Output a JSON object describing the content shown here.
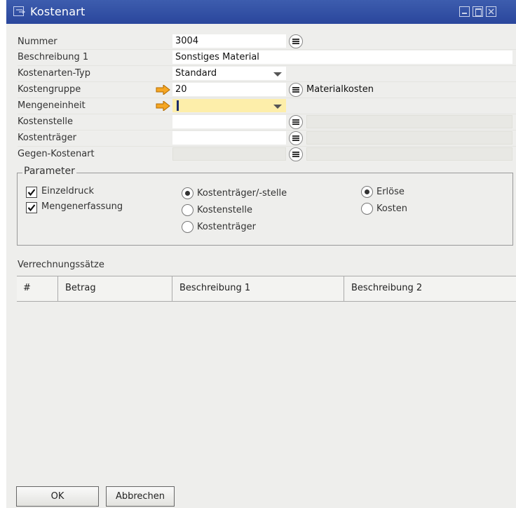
{
  "window": {
    "title": "Kostenart"
  },
  "fields": {
    "nummer": {
      "label": "Nummer",
      "value": "3004"
    },
    "beschreibung1": {
      "label": "Beschreibung 1",
      "value": "Sonstiges Material"
    },
    "kostenarten_typ": {
      "label": "Kostenarten-Typ",
      "value": "Standard"
    },
    "kostengruppe": {
      "label": "Kostengruppe",
      "value": "20",
      "description": "Materialkosten"
    },
    "mengeneinheit": {
      "label": "Mengeneinheit",
      "value": ""
    },
    "kostenstelle": {
      "label": "Kostenstelle",
      "value": ""
    },
    "kostentraeger": {
      "label": "Kostenträger",
      "value": ""
    },
    "gegen_kostenart": {
      "label": "Gegen-Kostenart",
      "value": ""
    }
  },
  "parameter": {
    "title": "Parameter",
    "checkboxes": [
      {
        "label": "Einzeldruck",
        "checked": true
      },
      {
        "label": "Mengenerfassung",
        "checked": true
      }
    ],
    "assignment_radios": [
      {
        "label": "Kostenträger/-stelle",
        "selected": true
      },
      {
        "label": "Kostenstelle",
        "selected": false
      },
      {
        "label": "Kostenträger",
        "selected": false
      }
    ],
    "type_radios": [
      {
        "label": "Erlöse",
        "selected": true
      },
      {
        "label": "Kosten",
        "selected": false
      }
    ]
  },
  "rates": {
    "title": "Verrechnungssätze",
    "columns": [
      "#",
      "Betrag",
      "Beschreibung 1",
      "Beschreibung 2"
    ],
    "rows": []
  },
  "buttons": {
    "ok": "OK",
    "cancel": "Abbrechen"
  },
  "colors": {
    "titlebar": "#2f4ea3",
    "required_arrow": "#f5a623",
    "focus_field": "#fdeeaa"
  }
}
